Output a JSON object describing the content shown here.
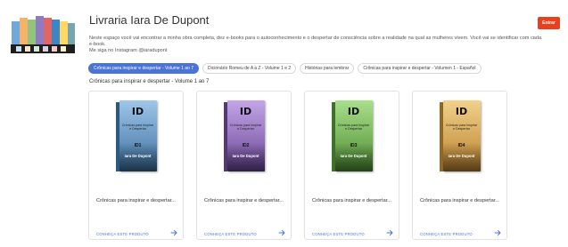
{
  "header": {
    "title": "Livraria Iara De Dupont",
    "enter_label": "Entrar",
    "description": [
      "Neste espaço você vai encontrar a minha obra completa, dez e-books para o autoconhecimento e o despertar de consciência sobre a realidade na qual as mulheres vivem. Você vai se identificar com cada e-book.",
      "Me siga no Instagram @iaradupont"
    ]
  },
  "tabs": [
    {
      "label": "Crônicas para inspirar e despertar - Volume 1 ao 7",
      "active": true
    },
    {
      "label": "Dicionário Romeu de A a Z - Volume 1 e 2",
      "active": false
    },
    {
      "label": "Histórias para lembrar",
      "active": false
    },
    {
      "label": "Crônicas para inspirar e despertar - Volumen 1 - Español",
      "active": false
    }
  ],
  "section_title": "Crônicas para inspirar e despertar - Volume 1 ao 7",
  "products": [
    {
      "title": "Crônicas para inspirar e despertar...",
      "link": "CONHEÇA ESTE PRODUTO",
      "cover": {
        "id": "ID",
        "subtitle": "Crônicas para Inspirar e Despertar",
        "vol": "ID1",
        "author": "Iara De Dupont",
        "color_top": "#9fc6ea",
        "color_bottom": "#3b6f9d",
        "spine": "#2e5a80"
      }
    },
    {
      "title": "Crônicas para inspirar e despertar...",
      "link": "CONHEÇA ESTE PRODUTO",
      "cover": {
        "id": "ID",
        "subtitle": "Crônicas para Inspirar e Despertar",
        "vol": "ID2",
        "author": "Iara De Dupont",
        "color_top": "#c3a5e8",
        "color_bottom": "#6a4796",
        "spine": "#553879"
      }
    },
    {
      "title": "Crônicas para inspirar e despertar...",
      "link": "CONHEÇA ESTE PRODUTO",
      "cover": {
        "id": "ID",
        "subtitle": "Crônicas para Inspirar e Despertar",
        "vol": "ID3",
        "author": "Iara De Dupont",
        "color_top": "#a9df8a",
        "color_bottom": "#4f8f35",
        "spine": "#3e7329"
      }
    },
    {
      "title": "Crônicas para inspirar e despertar...",
      "link": "CONHEÇA ESTE PRODUTO",
      "cover": {
        "id": "ID",
        "subtitle": "Crônicas para Inspirar e Despertar",
        "vol": "ID4",
        "author": "Iara De Dupont",
        "color_top": "#f2d28a",
        "color_bottom": "#b9812f",
        "spine": "#966622"
      }
    }
  ],
  "colors": {
    "accent": "#4a73d6",
    "enter": "#e8401c"
  }
}
